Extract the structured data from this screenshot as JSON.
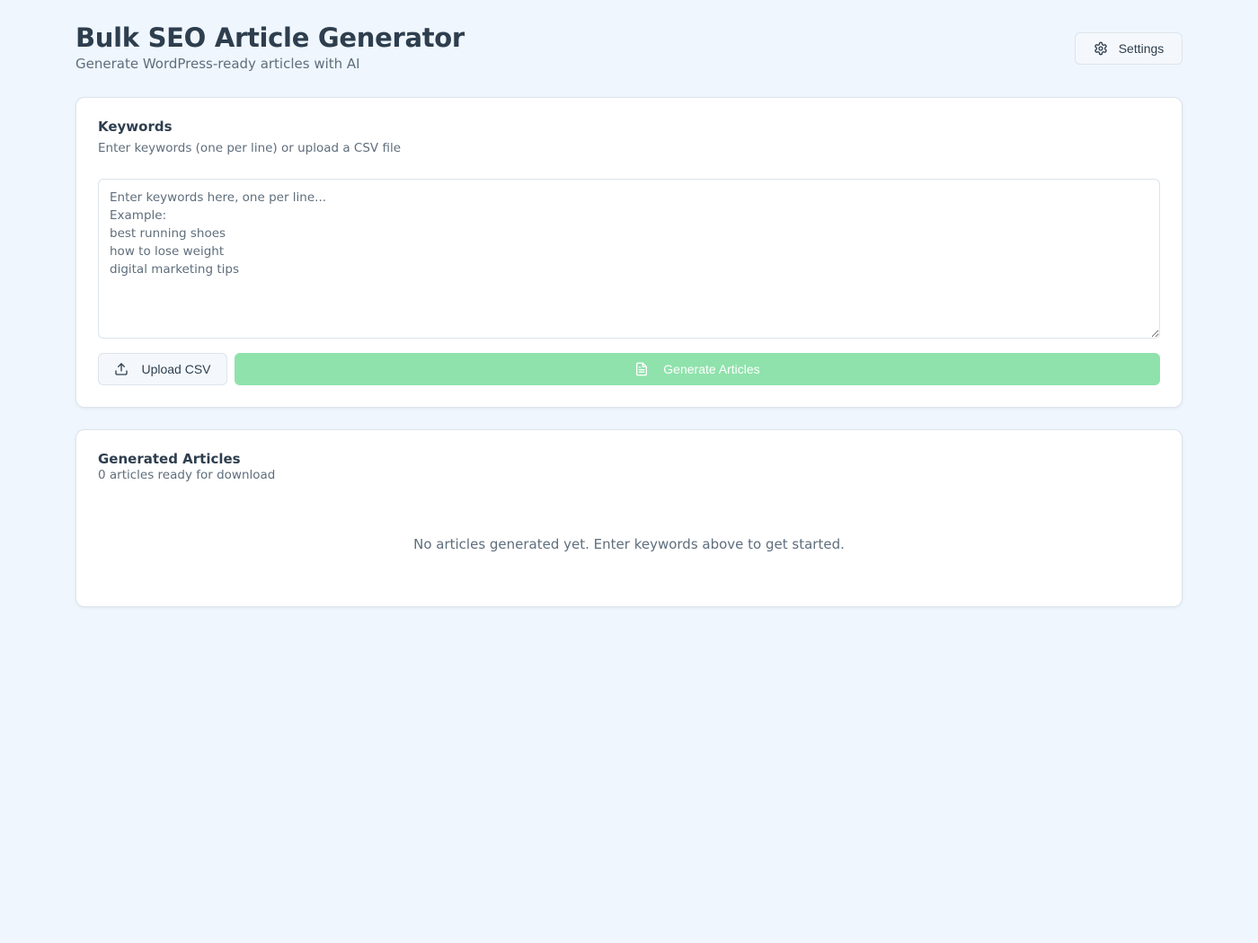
{
  "header": {
    "title": "Bulk SEO Article Generator",
    "subtitle": "Generate WordPress-ready articles with AI",
    "settings_label": "Settings",
    "settings_icon": "gear-icon"
  },
  "keywords": {
    "title": "Keywords",
    "description": "Enter keywords (one per line) or upload a CSV file",
    "placeholder": "Enter keywords here, one per line...\nExample:\nbest running shoes\nhow to lose weight\ndigital marketing tips",
    "value": "",
    "upload_label": "Upload CSV",
    "upload_icon": "upload-icon",
    "generate_label": "Generate Articles",
    "generate_icon": "file-text-icon",
    "generate_disabled": true
  },
  "articles": {
    "title": "Generated Articles",
    "count_text": "0 articles ready for download",
    "empty_message": "No articles generated yet. Enter keywords above to get started."
  },
  "colors": {
    "background": "#eff6fd",
    "accent_disabled": "#8fe2ab",
    "text_primary": "#2e3e4e",
    "text_muted": "#5f6e7c",
    "border": "#dde4ec"
  }
}
